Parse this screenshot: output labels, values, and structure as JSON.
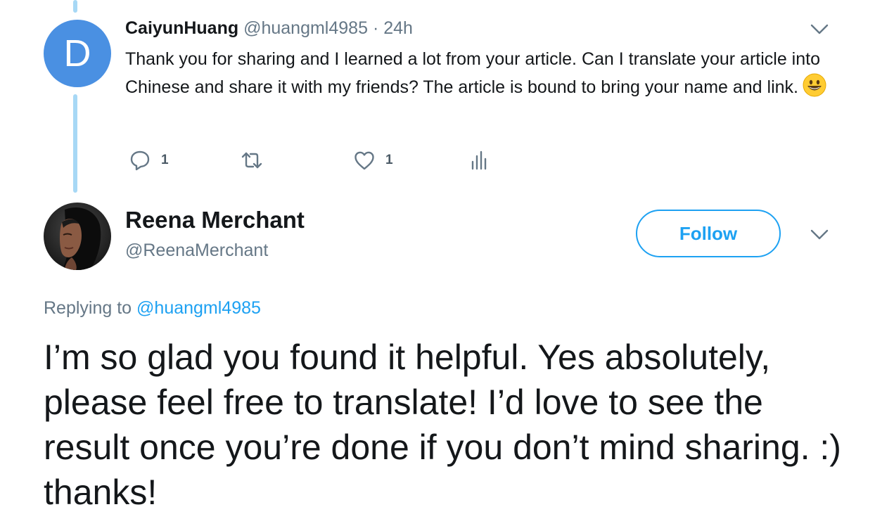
{
  "tweet1": {
    "avatar_letter": "D",
    "display_name": "CaiyunHuang",
    "handle": "@huangml4985",
    "separator": "·",
    "time": "24h",
    "text": "Thank you for sharing and I learned a lot from your article. Can I translate your article into Chinese and share it with my friends? The article is bound to bring your name and link.",
    "emoji_icon": "grinning-face-icon",
    "reply_count": "1",
    "like_count": "1"
  },
  "tweet2": {
    "display_name": "Reena Merchant",
    "handle": "@ReenaMerchant",
    "follow_label": "Follow",
    "replying_prefix": "Replying to",
    "replying_handle": "@huangml4985",
    "text": "I’m so glad you found it helpful. Yes absolutely, please feel free to translate! I’d love to see the result once you’re done if you don’t mind sharing. :) thanks!"
  },
  "colors": {
    "accent": "#1da1f2",
    "thread_line": "#a7d8f5",
    "avatar_bg": "#4a90e2",
    "muted_text": "#657786"
  }
}
